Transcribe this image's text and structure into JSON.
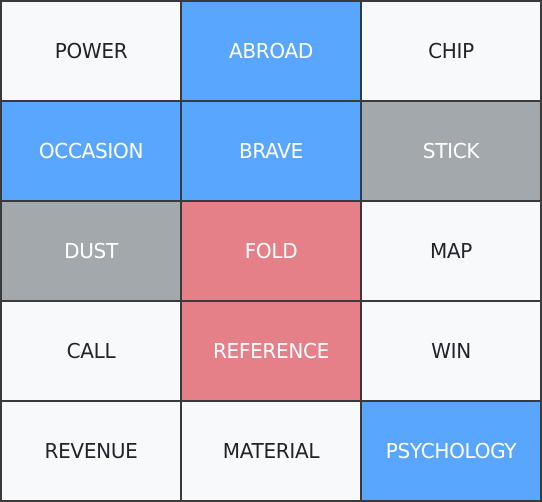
{
  "board": {
    "colors": {
      "neutral": "#f8f9fa",
      "blue": "#58a6ff",
      "gray": "#a3a8ad",
      "red": "#e57f88"
    },
    "cards": [
      {
        "word": "POWER",
        "state": "neutral"
      },
      {
        "word": "ABROAD",
        "state": "blue"
      },
      {
        "word": "CHIP",
        "state": "neutral"
      },
      {
        "word": "OCCASION",
        "state": "blue"
      },
      {
        "word": "BRAVE",
        "state": "blue"
      },
      {
        "word": "STICK",
        "state": "gray"
      },
      {
        "word": "DUST",
        "state": "gray"
      },
      {
        "word": "FOLD",
        "state": "red"
      },
      {
        "word": "MAP",
        "state": "neutral"
      },
      {
        "word": "CALL",
        "state": "neutral"
      },
      {
        "word": "REFERENCE",
        "state": "red"
      },
      {
        "word": "WIN",
        "state": "neutral"
      },
      {
        "word": "REVENUE",
        "state": "neutral"
      },
      {
        "word": "MATERIAL",
        "state": "neutral"
      },
      {
        "word": "PSYCHOLOGY",
        "state": "blue"
      }
    ]
  }
}
